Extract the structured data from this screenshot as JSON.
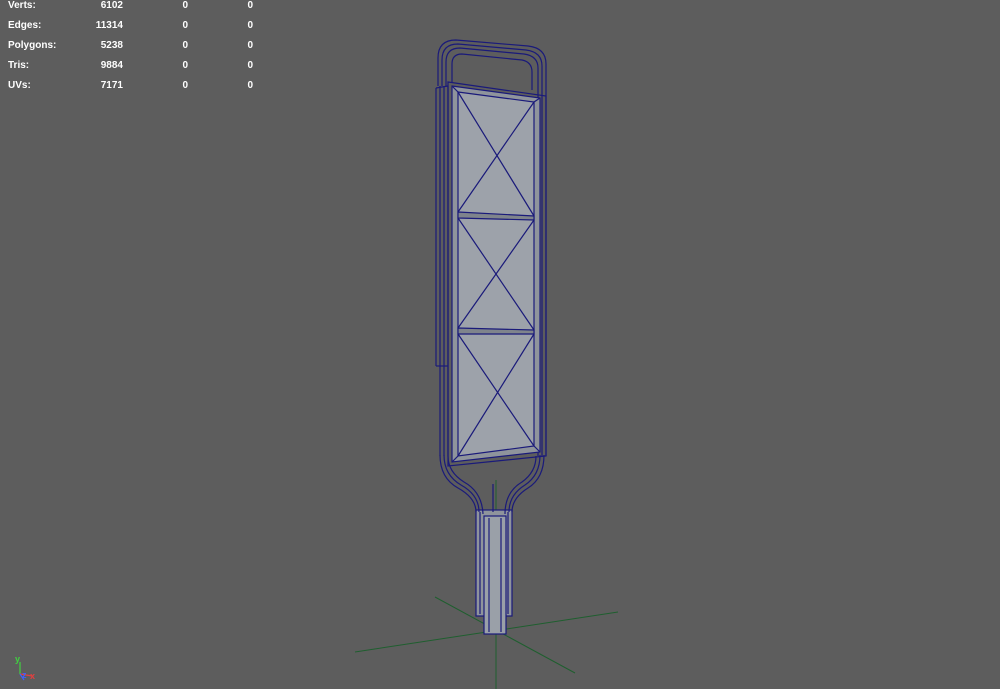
{
  "hud": {
    "rows": [
      {
        "label": "Verts:",
        "v1": "6102",
        "v2": "0",
        "v3": "0"
      },
      {
        "label": "Edges:",
        "v1": "11314",
        "v2": "0",
        "v3": "0"
      },
      {
        "label": "Polygons:",
        "v1": "5238",
        "v2": "0",
        "v3": "0"
      },
      {
        "label": "Tris:",
        "v1": "9884",
        "v2": "0",
        "v3": "0"
      },
      {
        "label": "UVs:",
        "v1": "7171",
        "v2": "0",
        "v3": "0"
      }
    ]
  },
  "gizmo": {
    "y_label": "y",
    "z_label": "z",
    "x_label": "x",
    "colors": {
      "x": "#e04040",
      "y": "#40d040",
      "z": "#4060ff"
    }
  },
  "colors": {
    "background": "#5d5d5d",
    "wire": "#1a1a7a",
    "surface": "#8f949c",
    "grid": "#1f5f2f"
  }
}
